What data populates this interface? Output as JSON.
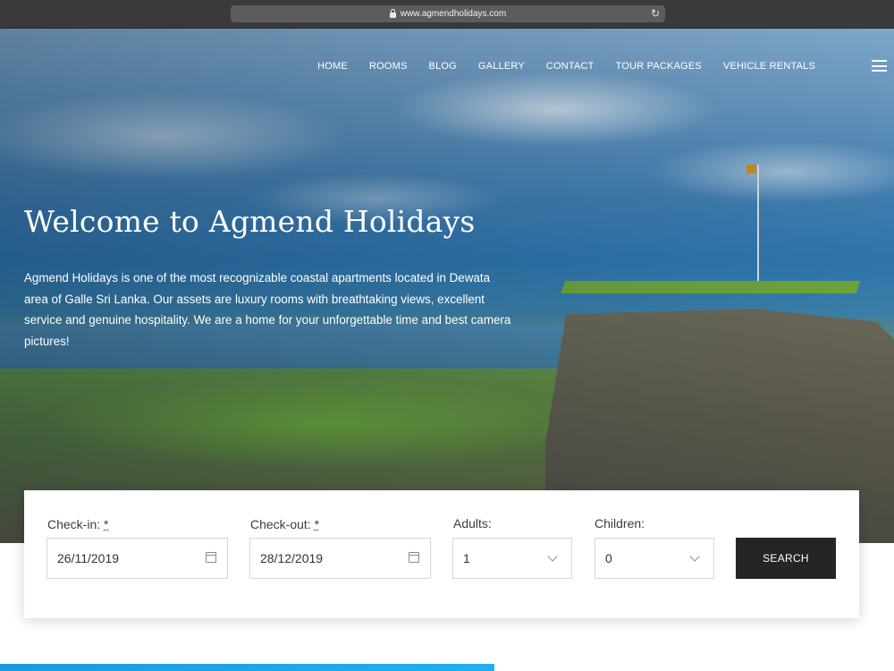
{
  "browser": {
    "url": "www.agmendholidays.com"
  },
  "nav": {
    "items": [
      "HOME",
      "ROOMS",
      "BLOG",
      "GALLERY",
      "CONTACT",
      "TOUR PACKAGES",
      "VEHICLE RENTALS"
    ]
  },
  "hero": {
    "title": "Welcome to Agmend Holidays",
    "text": "Agmend Holidays is one of the most recognizable coastal apartments located in Dewata area of Galle Sri Lanka. Our assets are luxury rooms with breathtaking views, excellent service and genuine hospitality. We are a home for your unforgettable time and best camera pictures!"
  },
  "booking": {
    "checkin_label": "Check-in:",
    "checkin_value": "26/11/2019",
    "checkout_label": "Check-out:",
    "checkout_value": "28/12/2019",
    "required_mark": "*",
    "adults_label": "Adults:",
    "adults_value": "1",
    "children_label": "Children:",
    "children_value": "0",
    "search_label": "SEARCH"
  },
  "colors": {
    "accent_blue": "#1a9be0",
    "button_dark": "#252525"
  },
  "icons": [
    "lock-icon",
    "reload-icon",
    "menu-icon",
    "calendar-icon",
    "chevron-down-icon"
  ]
}
